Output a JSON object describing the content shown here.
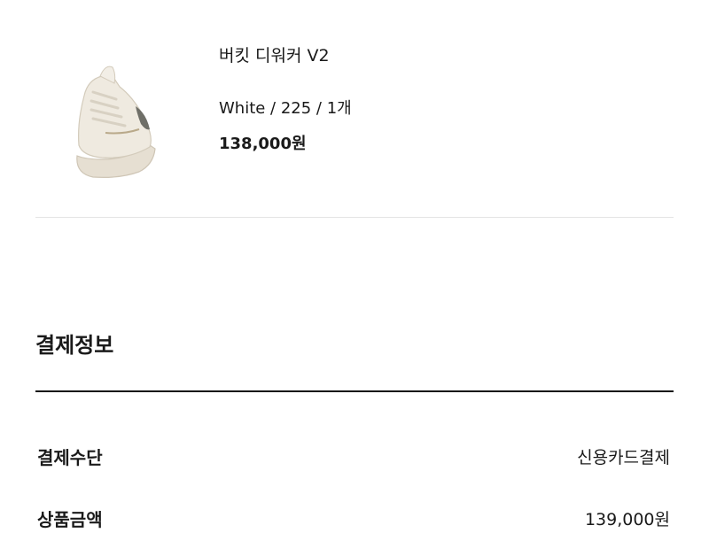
{
  "product": {
    "image_icon": "sneaker-image",
    "name": "버킷 디워커 V2",
    "option": "White / 225 / 1개",
    "price": "138,000원"
  },
  "payment_info": {
    "title": "결제정보",
    "rows": [
      {
        "label": "결제수단",
        "value": "신용카드결제"
      },
      {
        "label": "상품금액",
        "value": "139,000원"
      }
    ]
  },
  "colors": {
    "text": "#1a1a1a",
    "divider_light": "#e4e4e4",
    "divider_dark": "#111111",
    "shoe_body": "#ece7dc"
  }
}
